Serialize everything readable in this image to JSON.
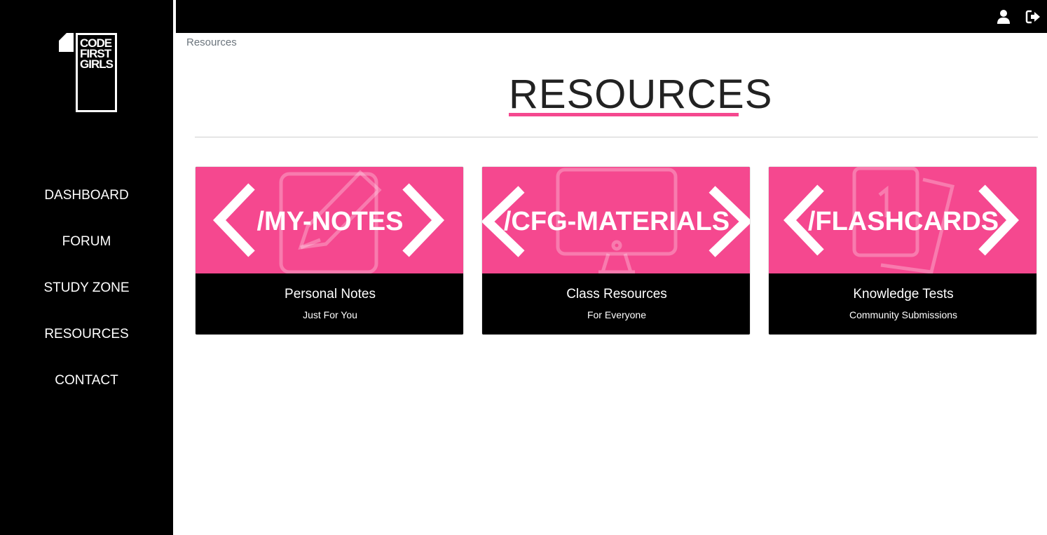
{
  "brand": {
    "logo_lines": [
      "CODE",
      "FIRST",
      "GIRLS"
    ],
    "logo_icon": "code-first-girls-logo"
  },
  "sidebar": {
    "items": [
      {
        "label": "DASHBOARD"
      },
      {
        "label": "FORUM"
      },
      {
        "label": "STUDY ZONE"
      },
      {
        "label": "RESOURCES"
      },
      {
        "label": "CONTACT"
      }
    ]
  },
  "topbar": {
    "icons": [
      "user-icon",
      "logout-icon"
    ]
  },
  "breadcrumb": "Resources",
  "page": {
    "title": "RESOURCES"
  },
  "cards": [
    {
      "code": "/MY-NOTES",
      "title": "Personal Notes",
      "subtitle": "Just For You",
      "icon": "notepad-pencil-icon"
    },
    {
      "code": "/CFG-MATERIALS",
      "title": "Class Resources",
      "subtitle": "For Everyone",
      "icon": "monitor-icon"
    },
    {
      "code": "/FLASHCARDS",
      "title": "Knowledge Tests",
      "subtitle": "Community Submissions",
      "icon": "flashcards-icon"
    }
  ],
  "colors": {
    "accent": "#f5488f",
    "sidebar": "#000000",
    "text_dark": "#222222",
    "muted": "#6c757d"
  }
}
